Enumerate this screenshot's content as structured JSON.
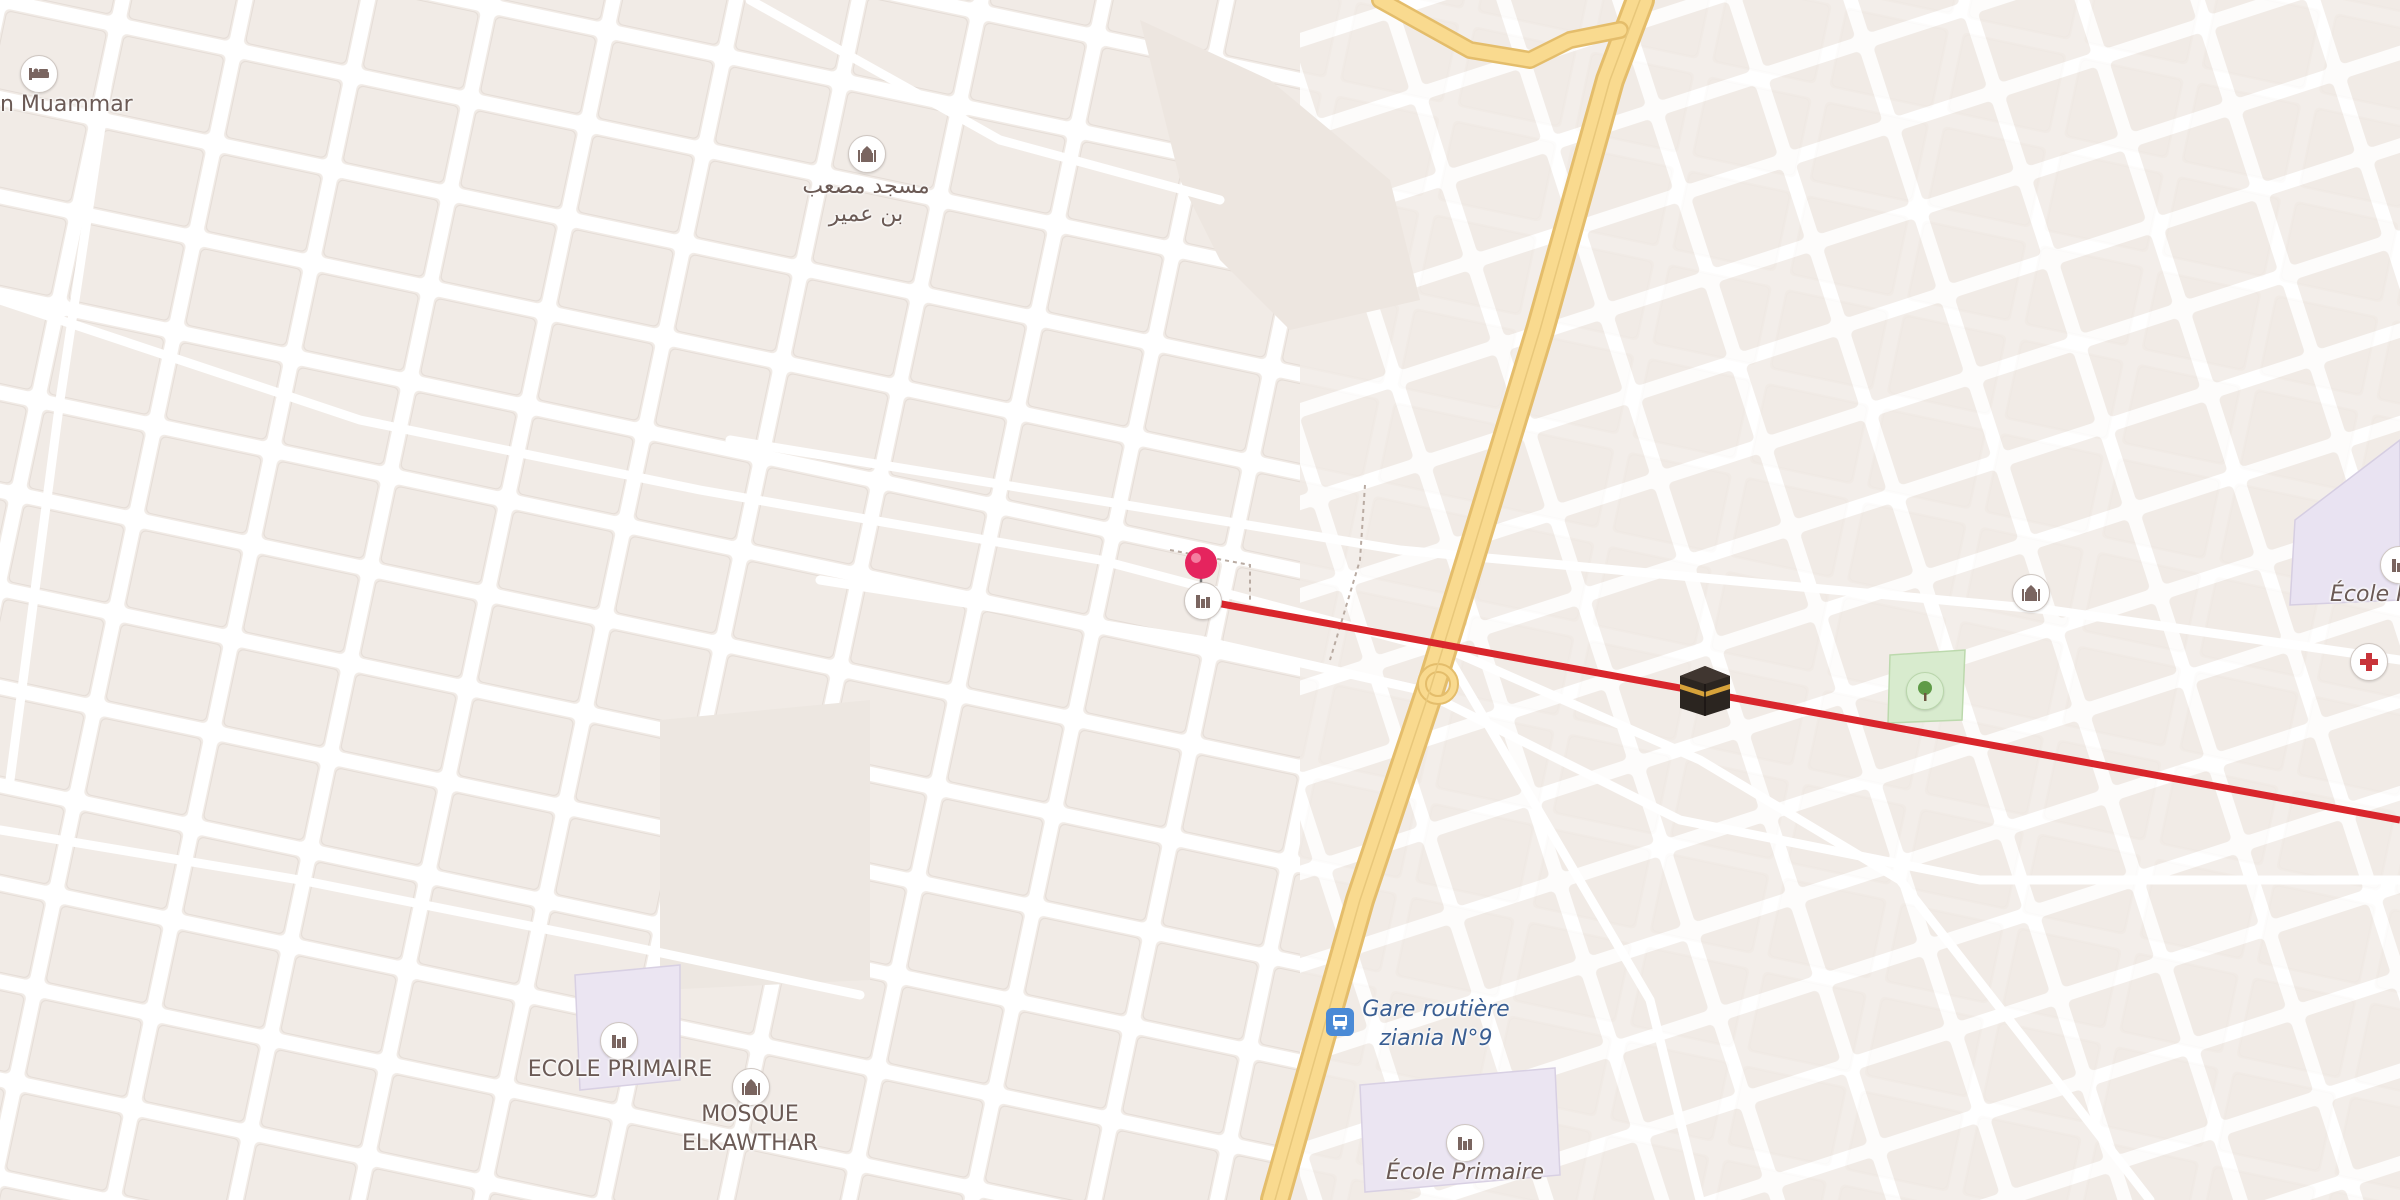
{
  "map": {
    "labels": {
      "muammar": "n Muammar",
      "mosque_arabic_line1": "مسجد مصعب",
      "mosque_arabic_line2": "بن عمير",
      "ecole_p_right": "École P",
      "gare_line1": "Gare routière",
      "gare_line2": "ziania N°9",
      "ecole_primaire_left": "ECOLE PRIMAIRE",
      "mosque_elkawthar_line1": "MOSQUE",
      "mosque_elkawthar_line2": "ELKAWTHAR",
      "ecole_primaire_bottom": "École Primaire"
    },
    "icons": {
      "hotel": "bed-icon",
      "mosque": "mosque-icon",
      "school": "school-icon",
      "bus": "bus-stop-icon",
      "park": "tree-icon",
      "pharmacy": "medical-cross-icon",
      "pin": "location-pin-icon",
      "kaaba": "kaaba-icon"
    },
    "colors": {
      "land": "#e9e2dc",
      "block": "#f2ebe6",
      "street": "#ffffff",
      "main_road": "#f8d98d",
      "main_road_edge": "#e9c06d",
      "school_area": "#ebe6f2",
      "park_area": "#d9ecd0",
      "qibla_line": "#d9262c",
      "pin": "#e5245e"
    }
  }
}
